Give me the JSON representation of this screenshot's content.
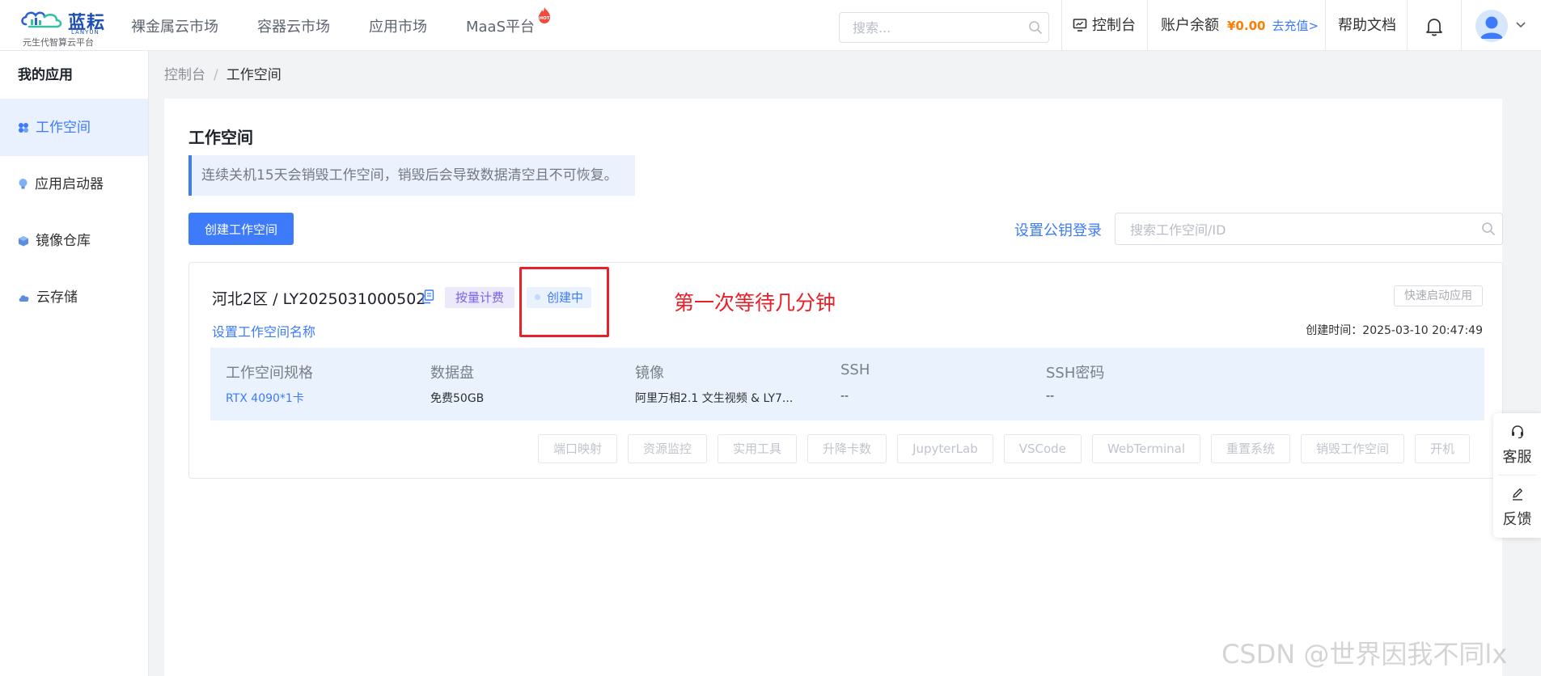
{
  "brand": {
    "name_cn": "蓝耘",
    "name_en": "LANYUN",
    "slogan": "元生代智算云平台"
  },
  "topnav": {
    "items": [
      {
        "label": "裸金属云市场"
      },
      {
        "label": "容器云市场"
      },
      {
        "label": "应用市场"
      },
      {
        "label": "MaaS平台",
        "badge": "HOT"
      }
    ]
  },
  "header": {
    "search_placeholder": "搜索...",
    "console_label": "控制台",
    "balance_label": "账户余额",
    "balance_amount": "¥0.00",
    "recharge_label": "去充值>",
    "help_label": "帮助文档"
  },
  "sidebar": {
    "title": "我的应用",
    "items": [
      {
        "label": "工作空间",
        "icon": "workspace-icon",
        "active": true
      },
      {
        "label": "应用启动器",
        "icon": "bulb-icon",
        "active": false
      },
      {
        "label": "镜像仓库",
        "icon": "cube-icon",
        "active": false
      },
      {
        "label": "云存储",
        "icon": "cloud-icon",
        "active": false
      }
    ]
  },
  "breadcrumb": {
    "root": "控制台",
    "separator": "/",
    "current": "工作空间"
  },
  "main": {
    "title": "工作空间",
    "notice": "连续关机15天会销毁工作空间，销毁后会导致数据清空且不可恢复。",
    "create_button": "创建工作空间",
    "ssh_link": "设置公钥登录",
    "search_placeholder": "搜索工作空间/ID"
  },
  "workspace": {
    "name": "河北2区 / LY2025031000502",
    "billing_tag": "按量计费",
    "status": "创建中",
    "annotation": "第一次等待几分钟",
    "quick_launch": "快速启动应用",
    "set_name_link": "设置工作空间名称",
    "created_label": "创建时间：",
    "created_time": "2025-03-10 20:47:49",
    "specs": [
      {
        "label": "工作空间规格",
        "value": "RTX 4090*1卡",
        "link": true
      },
      {
        "label": "数据盘",
        "value": "免费50GB",
        "link": false
      },
      {
        "label": "镜像",
        "value": "阿里万相2.1 文生视频 & LY7...",
        "link": false
      },
      {
        "label": "SSH",
        "value": "--",
        "link": false
      },
      {
        "label": "SSH密码",
        "value": "--",
        "link": false
      }
    ],
    "actions": [
      "端口映射",
      "资源监控",
      "实用工具",
      "升降卡数",
      "JupyterLab",
      "VSCode",
      "WebTerminal",
      "重置系统",
      "销毁工作空间",
      "开机"
    ]
  },
  "float_tools": {
    "service_label": "客服",
    "feedback_label": "反馈"
  },
  "watermark": "CSDN @世界因我不同lx",
  "colors": {
    "primary": "#3e7bfa",
    "annotation_red": "#e8202a",
    "balance_orange": "#ff7d00",
    "billing_purple": "#7b61e6"
  }
}
